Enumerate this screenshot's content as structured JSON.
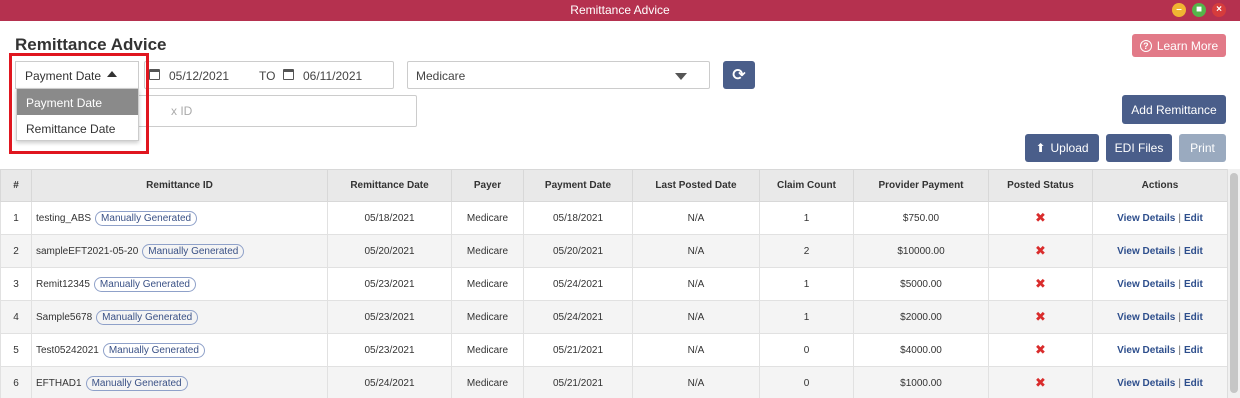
{
  "window": {
    "title": "Remittance Advice"
  },
  "page": {
    "title": "Remittance Advice"
  },
  "toolbar": {
    "learn_more": "Learn More",
    "add_remittance": "Add Remittance",
    "upload": "Upload",
    "edi_files": "EDI Files",
    "print": "Print"
  },
  "filters": {
    "date_type": {
      "selected": "Payment Date",
      "options": [
        "Payment Date",
        "Remittance Date"
      ]
    },
    "from_date": "05/12/2021",
    "to_label": "TO",
    "to_date": "06/11/2021",
    "payer": "Medicare",
    "search_placeholder": "x ID"
  },
  "colors": {
    "titlebar": "#b5314f",
    "primary_button": "#4a5e8a",
    "learn_more": "#e27a88",
    "highlight": "#e0161f",
    "status_x": "#d92c2c"
  },
  "table": {
    "headers": [
      "#",
      "Remittance ID",
      "Remittance Date",
      "Payer",
      "Payment Date",
      "Last Posted Date",
      "Claim Count",
      "Provider Payment",
      "Posted Status",
      "Actions"
    ],
    "tag_label": "Manually Generated",
    "status_icon": "close-icon",
    "view_details": "View Details",
    "sep": "|",
    "edit": "Edit",
    "rows": [
      {
        "num": "1",
        "id": "testing_ABS",
        "remit_date": "05/18/2021",
        "payer": "Medicare",
        "pay_date": "05/18/2021",
        "last_posted": "N/A",
        "claims": "1",
        "payment": "$750.00"
      },
      {
        "num": "2",
        "id": "sampleEFT2021-05-20",
        "remit_date": "05/20/2021",
        "payer": "Medicare",
        "pay_date": "05/20/2021",
        "last_posted": "N/A",
        "claims": "2",
        "payment": "$10000.00"
      },
      {
        "num": "3",
        "id": "Remit12345",
        "remit_date": "05/23/2021",
        "payer": "Medicare",
        "pay_date": "05/24/2021",
        "last_posted": "N/A",
        "claims": "1",
        "payment": "$5000.00"
      },
      {
        "num": "4",
        "id": "Sample5678",
        "remit_date": "05/23/2021",
        "payer": "Medicare",
        "pay_date": "05/24/2021",
        "last_posted": "N/A",
        "claims": "1",
        "payment": "$2000.00"
      },
      {
        "num": "5",
        "id": "Test05242021",
        "remit_date": "05/23/2021",
        "payer": "Medicare",
        "pay_date": "05/21/2021",
        "last_posted": "N/A",
        "claims": "0",
        "payment": "$4000.00"
      },
      {
        "num": "6",
        "id": "EFTHAD1",
        "remit_date": "05/24/2021",
        "payer": "Medicare",
        "pay_date": "05/21/2021",
        "last_posted": "N/A",
        "claims": "0",
        "payment": "$1000.00"
      }
    ]
  }
}
